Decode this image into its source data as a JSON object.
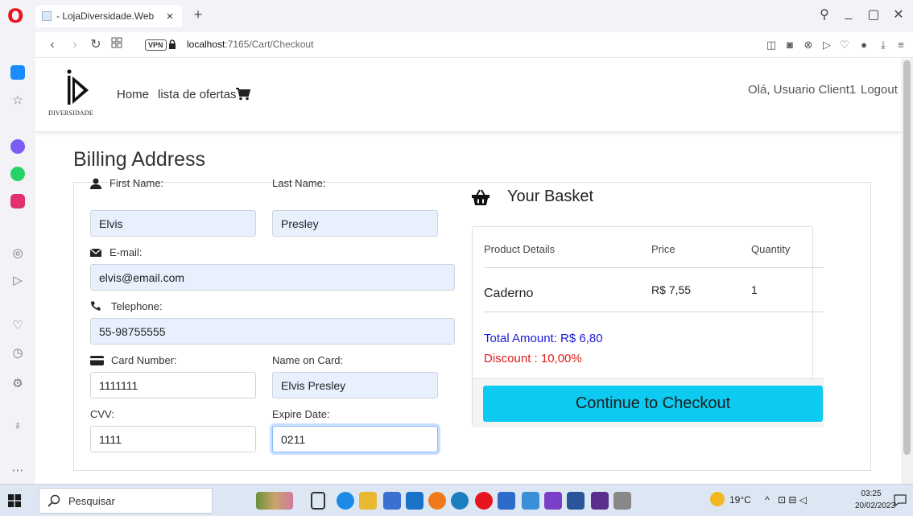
{
  "browser": {
    "tab_title": "- LojaDiversidade.Web",
    "tab_close": "×",
    "new_tab": "+",
    "url_host": "localhost",
    "url_path": ":7165/Cart/Checkout",
    "vpn": "VPN",
    "controls": {
      "search": "⚲",
      "minimize": "_",
      "maximize": "▢",
      "close": "✕"
    }
  },
  "site": {
    "logo_text": "DIVERSIDADE",
    "nav": {
      "home": "Home",
      "offers": "lista de ofertas"
    },
    "greeting": "Olá, Usuario Client1",
    "logout": "Logout"
  },
  "page": {
    "title": "Billing Address"
  },
  "form": {
    "first_name": {
      "label": "First Name:",
      "value": "Elvis"
    },
    "last_name": {
      "label": "Last Name:",
      "value": "Presley"
    },
    "email": {
      "label": "E-mail:",
      "value": "elvis@email.com"
    },
    "telephone": {
      "label": "Telephone:",
      "value": "55-98755555"
    },
    "card_number": {
      "label": "Card Number:",
      "value": "1111111"
    },
    "name_on_card": {
      "label": "Name on Card:",
      "value": "Elvis Presley"
    },
    "cvv": {
      "label": "CVV:",
      "value": "1111"
    },
    "expire_date": {
      "label": "Expire Date:",
      "value": "0211"
    }
  },
  "basket": {
    "title": "Your Basket",
    "headers": {
      "product": "Product Details",
      "price": "Price",
      "quantity": "Quantity"
    },
    "items": [
      {
        "product": "Caderno",
        "price": "R$ 7,55",
        "quantity": "1"
      }
    ],
    "total": "Total Amount: R$ 6,80",
    "discount": "Discount : 10,00%",
    "checkout_label": "Continue to Checkout",
    "colors": {
      "button": "#0dcaf0",
      "total": "#1b1bd8",
      "discount": "#e01b1b"
    }
  },
  "taskbar": {
    "search_placeholder": "Pesquisar",
    "weather": "19°C",
    "time": "03:25",
    "date": "20/02/2023"
  }
}
